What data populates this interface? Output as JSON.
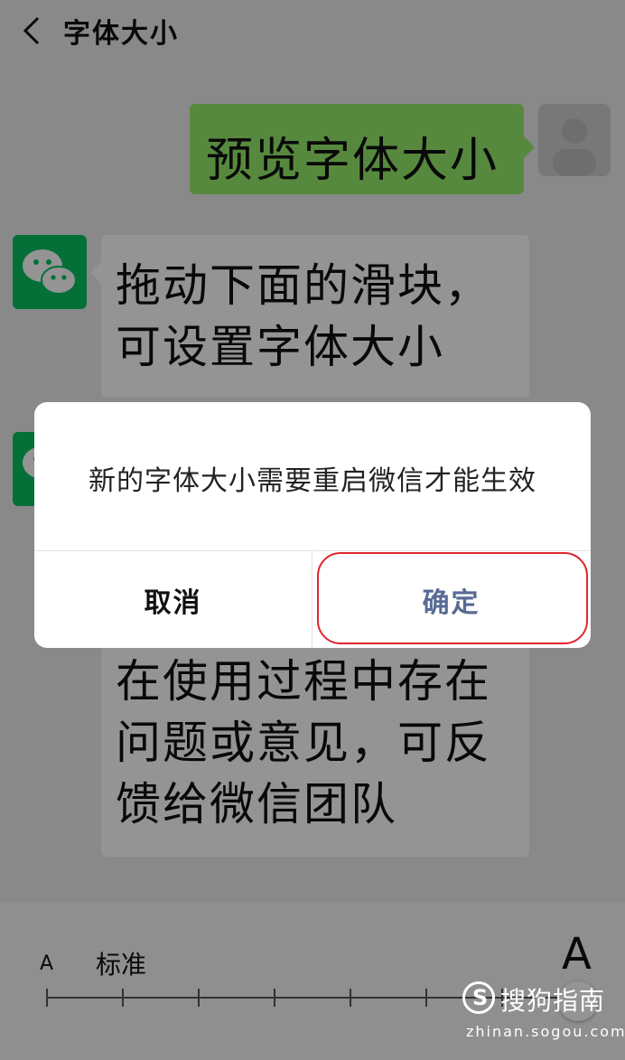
{
  "header": {
    "title": "字体大小"
  },
  "chat": {
    "preview_bubble": "预览字体大小",
    "bubble_1": "拖动下面的滑块，可设置字体大小",
    "bubble_3": "在使用过程中存在问题或意见，可反馈给微信团队"
  },
  "slider": {
    "small_label": "A",
    "standard_label": "标准",
    "large_label": "A",
    "tick_count": 8,
    "selected_level": 8
  },
  "dialog": {
    "message": "新的字体大小需要重启微信才能生效",
    "cancel_label": "取消",
    "confirm_label": "确定"
  },
  "watermark": {
    "logo_letter": "S",
    "name": "搜狗指南",
    "url": "zhinan.sogou.com"
  },
  "colors": {
    "accent": "#576b95",
    "wechat_green": "#07c160",
    "bubble_green": "#95ec69",
    "highlight": "#e0262b"
  }
}
